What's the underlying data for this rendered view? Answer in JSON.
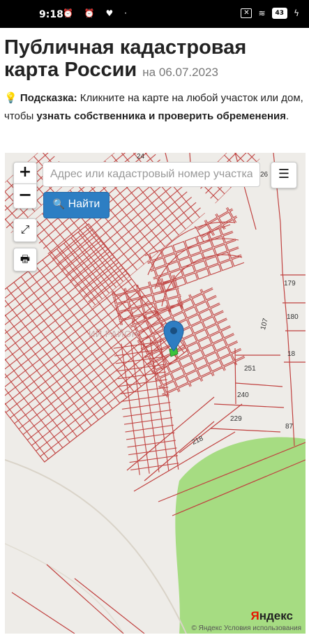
{
  "status_bar": {
    "time": "9:18",
    "battery": "43",
    "left_icons": "⏰ ⏰ ♥ ·",
    "right_icons": "☒ ≋"
  },
  "header": {
    "title": "Публичная кадастровая карта России",
    "date": "на 06.07.2023"
  },
  "hint": {
    "icon": "💡",
    "label": "Подсказка:",
    "text_1": " Кликните на карте на любой участок или дом, чтобы ",
    "bold_1": "узнать собственника и проверить обременения",
    "text_2": "."
  },
  "map": {
    "zoom_in_label": "+",
    "zoom_out_label": "−",
    "fullscreen_icon": "⤢",
    "print_icon": "🖶",
    "search_placeholder": "Адрес или кадастровый номер участка",
    "menu_icon": "☰",
    "find_button_icon": "🔍",
    "find_button_label": "Найти",
    "district_label": "ИЙ РАЙОН",
    "parcel_numbers": [
      "24",
      "26",
      "179",
      "180",
      "18",
      "107",
      "251",
      "240",
      "229",
      "87",
      "218"
    ],
    "attribution": "© Яндекс  Условия использования",
    "logo_y": "Я",
    "logo_rest": "ндекс",
    "colors": {
      "parcel": "#c0413f",
      "marker": "#2e7dc2",
      "forest": "#a6dc82",
      "button": "#2d7ec3"
    }
  }
}
